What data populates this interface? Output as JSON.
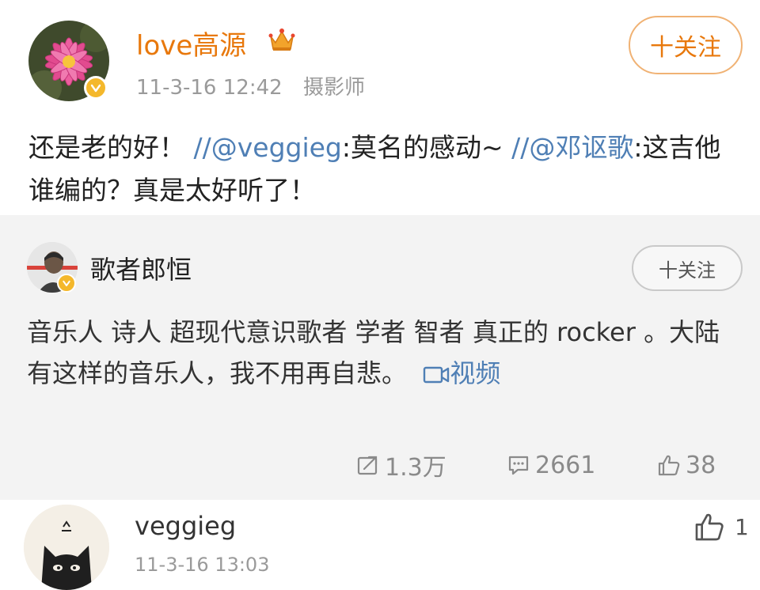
{
  "post": {
    "username": "love高源",
    "time": "11-3-16 12:42",
    "role": "摄影师",
    "follow_label": "十关注",
    "text_parts": [
      "还是老的好！ ",
      "//@veggieg",
      ":莫名的感动~ ",
      "//@邓讴歌",
      ":这吉他谁编的？真是太好听了！"
    ]
  },
  "repost": {
    "username": "歌者郎恒",
    "follow_label": "十关注",
    "text": "音乐人 诗人 超现代意识歌者  学者 智者 真正的 rocker 。大陆有这样的音乐人，我不用再自悲。",
    "video_label": "视频",
    "stats": {
      "shares": "1.3万",
      "comments": "2661",
      "likes": "38"
    }
  },
  "comment": {
    "username": "veggieg",
    "time": "11-3-16 13:03",
    "likes": "1"
  },
  "colors": {
    "username_orange": "#e8780c",
    "link_blue": "#4f7fb5",
    "verify_gold": "#f4b82c",
    "repost_bg": "#f3f3f3"
  },
  "icons": [
    "lotus-avatar",
    "crown-icon",
    "verified-icon",
    "video-icon",
    "share-icon",
    "comment-icon",
    "like-icon",
    "cat-avatar"
  ]
}
